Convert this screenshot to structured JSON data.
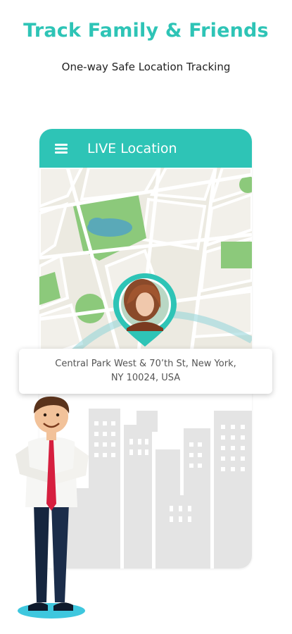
{
  "header": {
    "title": "Track Family & Friends",
    "subtitle": "One-way Safe Location Tracking"
  },
  "app_bar": {
    "title": "LIVE Location",
    "menu_icon": "hamburger-menu-icon"
  },
  "location": {
    "address_line1": "Central Park West & 70’th St, New York,",
    "address_line2": "NY 10024, USA"
  },
  "colors": {
    "accent": "#2ec4b6",
    "map_bg": "#eceae1",
    "park": "#8cc97b",
    "water": "#5aa9b8",
    "city": "#e4e4e4"
  }
}
